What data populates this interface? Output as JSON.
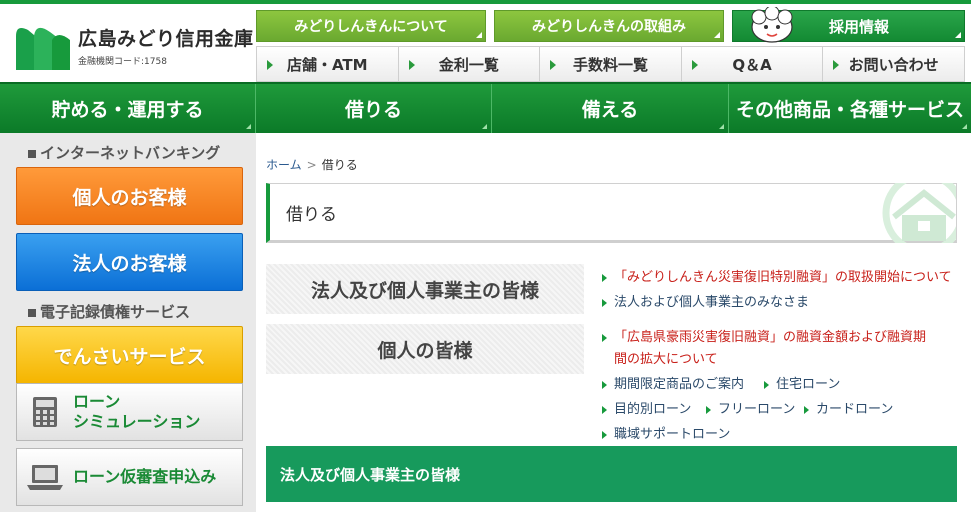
{
  "brand": {
    "name": "広島みどり信用金庫",
    "code": "金融機関コード:1758"
  },
  "top_buttons": {
    "about": "みどりしんきんについて",
    "initiatives": "みどりしんきんの取組み",
    "recruit": "採用情報"
  },
  "sub_nav": [
    "店舗・ATM",
    "金利一覧",
    "手数料一覧",
    "Q＆A",
    "お問い合わせ"
  ],
  "main_nav": [
    "貯める・運用する",
    "借りる",
    "備える",
    "その他商品・各種サービス"
  ],
  "sidebar": {
    "ib_heading": "インターネットバンキング",
    "personal": "個人のお客様",
    "corporate": "法人のお客様",
    "densai_heading": "電子記録債権サービス",
    "densai": "でんさいサービス",
    "loan_sim_line1": "ローン",
    "loan_sim_line2": "シミュレーション",
    "loan_apply": "ローン仮審査申込み"
  },
  "breadcrumb": {
    "home": "ホーム",
    "sep": ">",
    "current": "借りる"
  },
  "page_title": "借りる",
  "categories": {
    "business": "法人及び個人事業主の皆様",
    "personal": "個人の皆様"
  },
  "links": {
    "business": [
      "「みどりしんきん災害復旧特別融資」の取扱開始について",
      "法人および個人事業主のみなさま"
    ],
    "personal_notice_line1": "「広島県豪雨災害復旧融資」の融資金額および融資期",
    "personal_notice_line2": "間の拡大について",
    "personal_row1": [
      "期間限定商品のご案内",
      "住宅ローン"
    ],
    "personal_row2": [
      "目的別ローン",
      "フリーローン",
      "カードローン"
    ],
    "personal_row3": [
      "職域サポートローン"
    ]
  },
  "section_band": "法人及び個人事業主の皆様",
  "colors": {
    "brand_green": "#179a3c",
    "light_green": "#8dc63f",
    "orange": "#f07514",
    "blue": "#0b6fd6",
    "yellow": "#f5b500",
    "link_red": "#c8201a"
  }
}
